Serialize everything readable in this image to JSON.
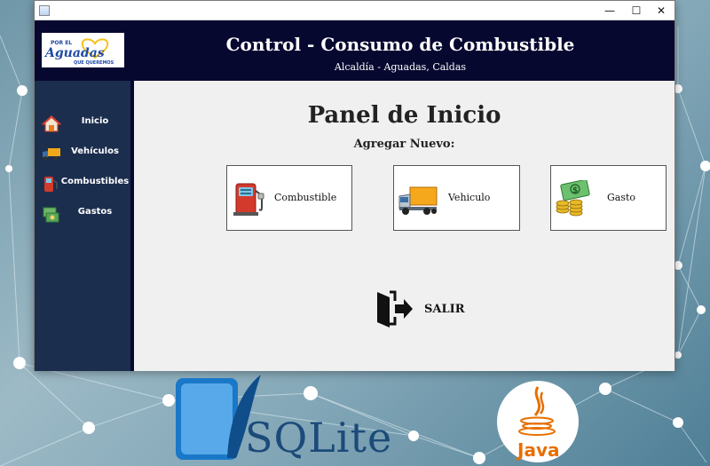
{
  "window": {
    "controls": {
      "minimize": "—",
      "maximize": "☐",
      "close": "✕"
    }
  },
  "header": {
    "logo_line1": "POR EL",
    "logo_line2": "Aguadas",
    "logo_line3": "QUE QUEREMOS",
    "title": "Control - Consumo de Combustible",
    "subtitle": "Alcaldía - Aguadas, Caldas"
  },
  "sidebar": {
    "items": [
      {
        "label": "Inicio",
        "icon": "home-icon"
      },
      {
        "label": "Vehículos",
        "icon": "truck-icon"
      },
      {
        "label": "Combustibles",
        "icon": "fuel-pump-icon"
      },
      {
        "label": "Gastos",
        "icon": "money-icon"
      }
    ]
  },
  "main": {
    "title": "Panel de Inicio",
    "subtitle": "Agregar Nuevo:",
    "cards": [
      {
        "label": "Combustible",
        "icon": "fuel-pump-icon"
      },
      {
        "label": "Vehiculo",
        "icon": "truck-icon"
      },
      {
        "label": "Gasto",
        "icon": "money-coins-icon"
      }
    ],
    "exit_label": "SALIR"
  },
  "desktop": {
    "sqlite_label": "SQLite",
    "java_label": "Java"
  },
  "colors": {
    "header_bg": "#070830",
    "sidebar_bg": "#1c2e4e",
    "main_bg": "#f0f0f0"
  }
}
